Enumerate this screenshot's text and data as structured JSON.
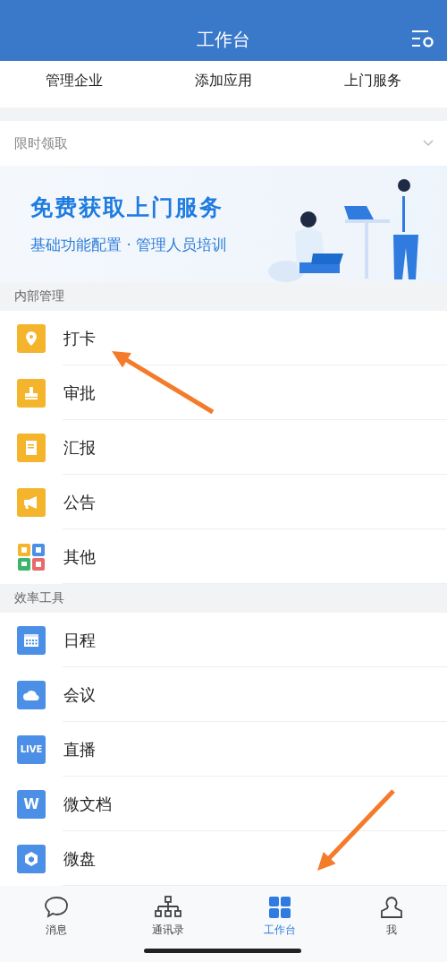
{
  "header": {
    "title": "工作台"
  },
  "quick_actions": [
    "管理企业",
    "添加应用",
    "上门服务"
  ],
  "promo": {
    "label": "限时领取",
    "expanded": false,
    "banner_title": "免费获取上门服务",
    "banner_subtitle": "基础功能配置 · 管理人员培训"
  },
  "sections": [
    {
      "title": "内部管理",
      "color": "#f4b42b",
      "items": [
        "打卡",
        "审批",
        "汇报",
        "公告",
        "其他"
      ]
    },
    {
      "title": "效率工具",
      "color": "#4b8fe6",
      "items": [
        "日程",
        "会议",
        "直播",
        "微文档",
        "微盘"
      ]
    }
  ],
  "tabs": [
    {
      "label": "消息",
      "selected": false
    },
    {
      "label": "通讯录",
      "selected": false
    },
    {
      "label": "工作台",
      "selected": true
    },
    {
      "label": "我",
      "selected": false
    }
  ],
  "icon_texts": {
    "live": "LIVE",
    "doc": "W"
  }
}
